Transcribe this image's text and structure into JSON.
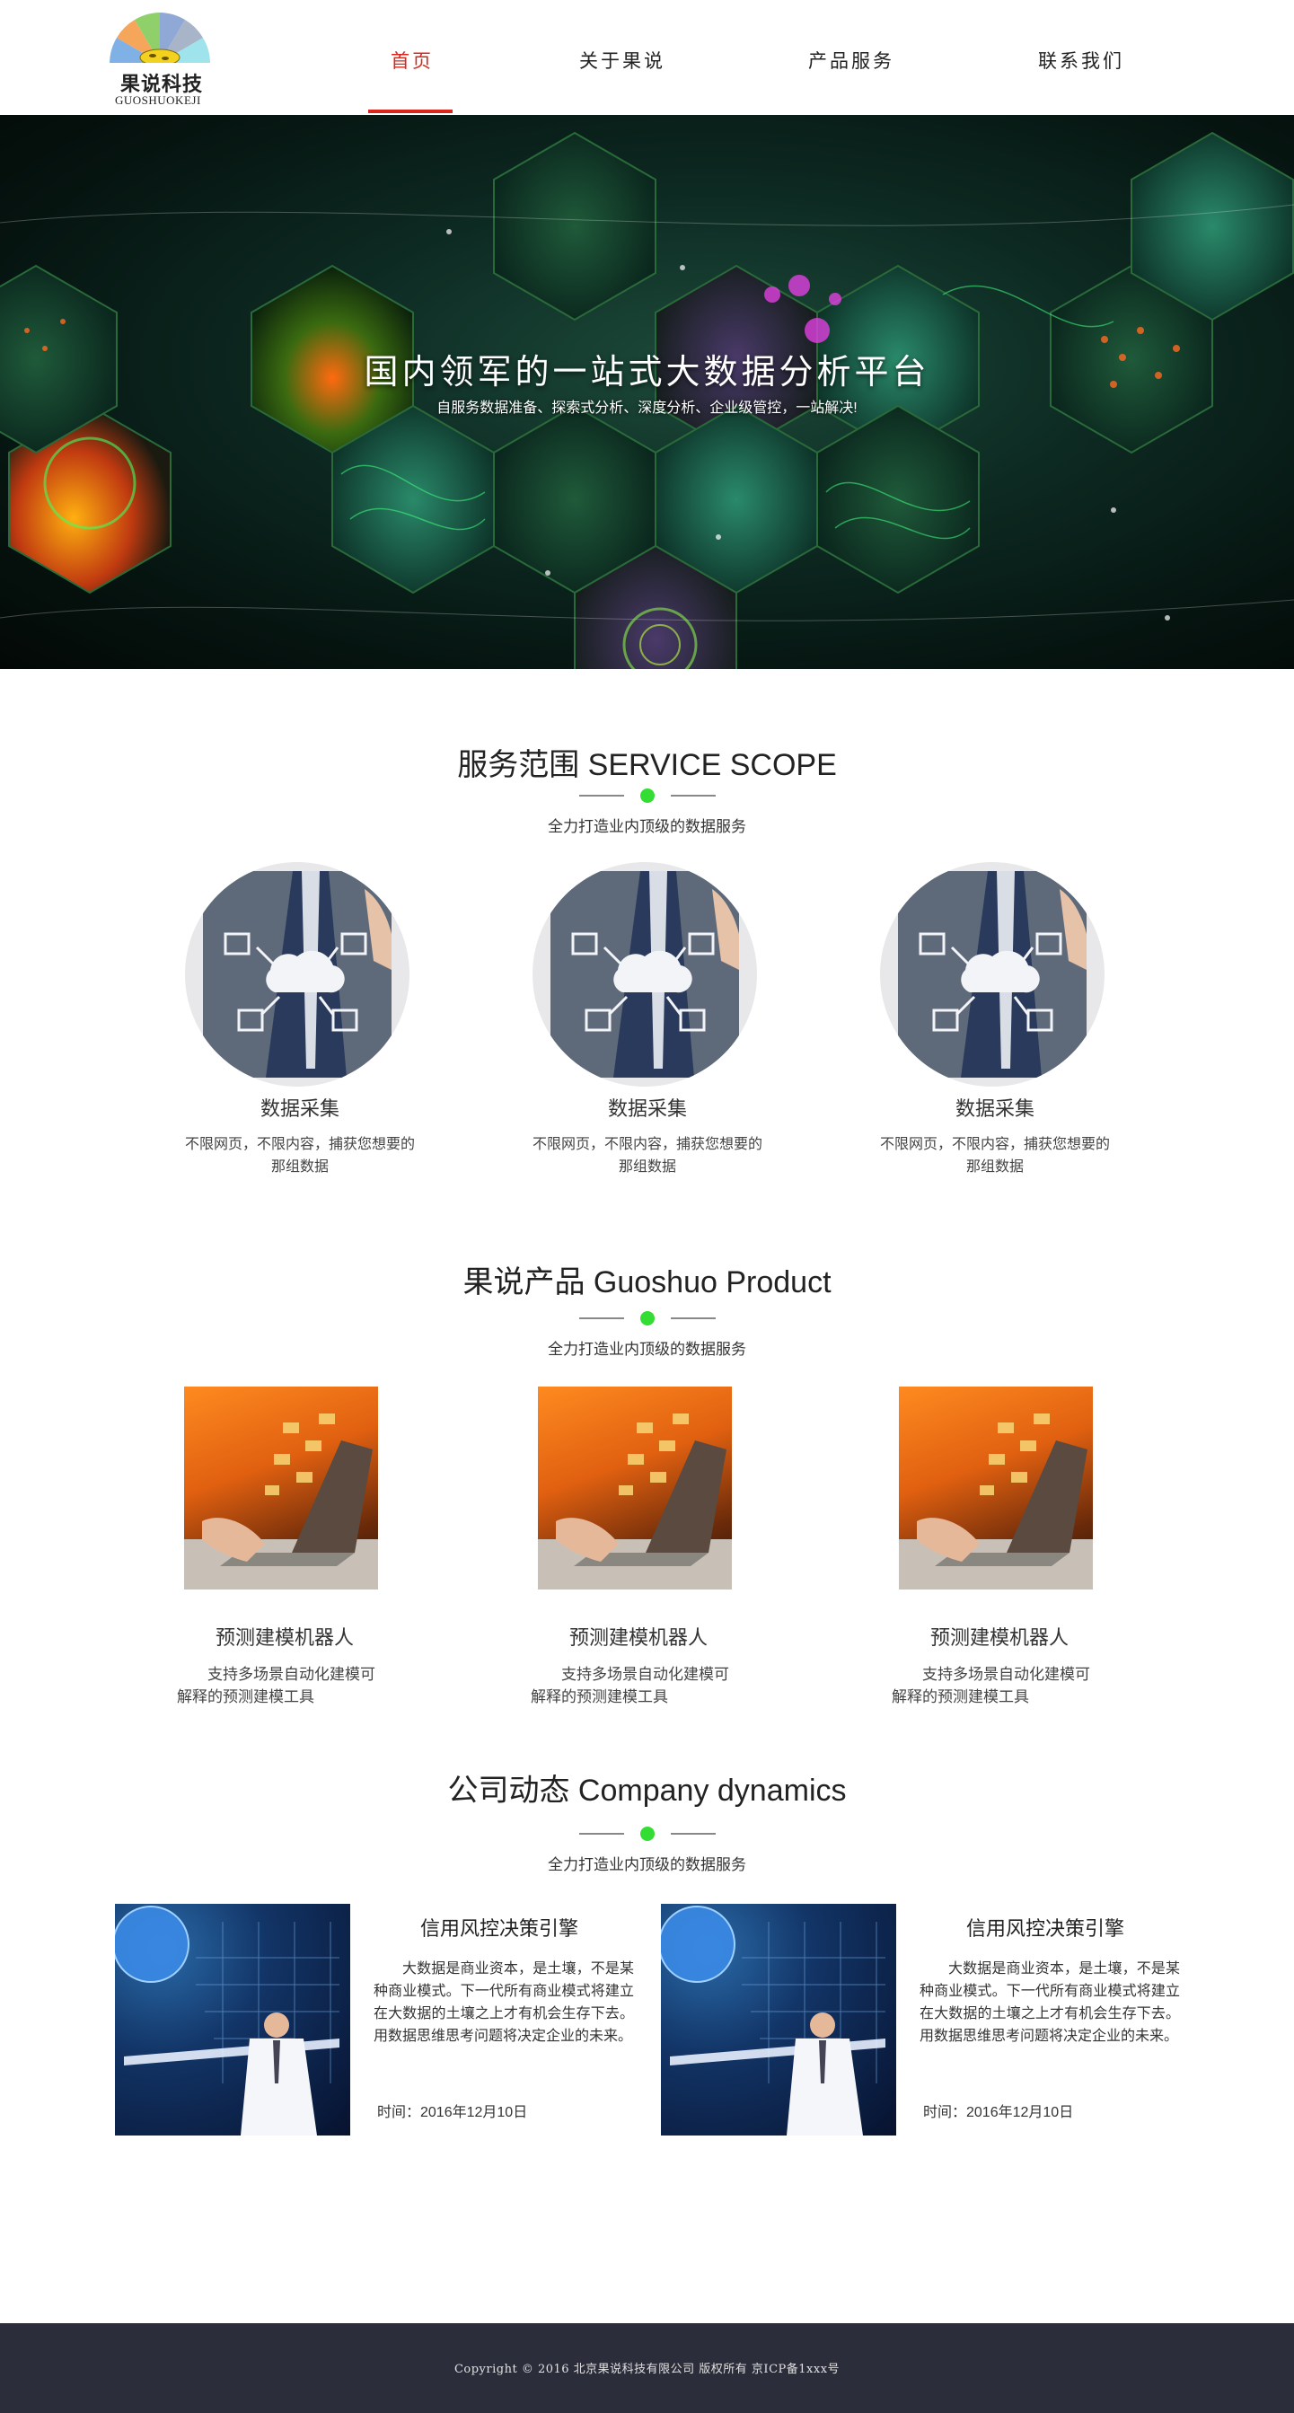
{
  "logo": {
    "name_cn": "果说科技",
    "name_en": "GUOSHUOKEJI"
  },
  "nav": {
    "items": [
      {
        "label": "首页"
      },
      {
        "label": "关于果说"
      },
      {
        "label": "产品服务"
      },
      {
        "label": "联系我们"
      }
    ],
    "active_index": 0,
    "active_color": "#d9261c"
  },
  "banner": {
    "title": "国内领军的一站式大数据分析平台",
    "subtitle": "自服务数据准备、探索式分析、深度分析、企业级管控，一站解决!"
  },
  "services": {
    "title": "服务范围  SERVICE SCOPE",
    "subtitle": "全力打造业内顶级的数据服务",
    "items": [
      {
        "name": "数据采集",
        "desc": "不限网页，不限内容，捕获您想要的那组数据"
      },
      {
        "name": "数据采集",
        "desc": "不限网页，不限内容，捕获您想要的那组数据"
      },
      {
        "name": "数据采集",
        "desc": "不限网页，不限内容，捕获您想要的那组数据"
      }
    ]
  },
  "products": {
    "title": "果说产品 Guoshuo Product",
    "subtitle": "全力打造业内顶级的数据服务",
    "items": [
      {
        "name": "预测建模机器人",
        "desc": "支持多场景自动化建模可解释的预测建模工具"
      },
      {
        "name": "预测建模机器人",
        "desc": "支持多场景自动化建模可解释的预测建模工具"
      },
      {
        "name": "预测建模机器人",
        "desc": "支持多场景自动化建模可解释的预测建模工具"
      }
    ]
  },
  "news": {
    "title": "公司动态 Company dynamics",
    "subtitle": "全力打造业内顶级的数据服务",
    "items": [
      {
        "title": "信用风控决策引擎",
        "body": "大数据是商业资本，是土壤，不是某种商业模式。下一代所有商业模式将建立在大数据的土壤之上才有机会生存下去。用数据思维思考问题将决定企业的未来。",
        "time": "时间：2016年12月10日"
      },
      {
        "title": "信用风控决策引擎",
        "body": "大数据是商业资本，是土壤，不是某种商业模式。下一代所有商业模式将建立在大数据的土壤之上才有机会生存下去。用数据思维思考问题将决定企业的未来。",
        "time": "时间：2016年12月10日"
      }
    ]
  },
  "footer": {
    "text": "Copyright © 2016  北京果说科技有限公司 版权所有   京ICP备1xxx号"
  },
  "colors": {
    "accent_dot": "#33dd33",
    "footer_bg": "#2b2d3a"
  }
}
